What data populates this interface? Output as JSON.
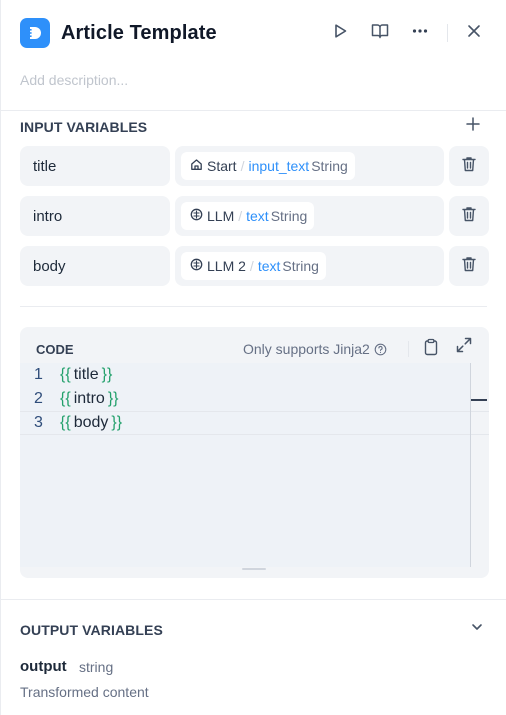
{
  "header": {
    "title": "Article Template",
    "run_icon": "play-icon",
    "docs_icon": "book-open-icon",
    "more_icon": "more-horizontal-icon",
    "close_icon": "close-icon"
  },
  "description_placeholder": "Add description...",
  "input_section": {
    "title": "INPUT VARIABLES",
    "add_icon": "plus-icon",
    "variables": [
      {
        "name": "title",
        "node_icon": "home-icon",
        "node": "Start",
        "var": "input_text",
        "type": "String"
      },
      {
        "name": "intro",
        "node_icon": "llm-icon",
        "node": "LLM",
        "var": "text",
        "type": "String"
      },
      {
        "name": "body",
        "node_icon": "llm-icon",
        "node": "LLM 2",
        "var": "text",
        "type": "String"
      }
    ]
  },
  "code": {
    "label": "CODE",
    "hint": "Only supports Jinja2",
    "lines": [
      {
        "num": "1",
        "open": "{{",
        "var": "title",
        "close": "}}"
      },
      {
        "num": "2",
        "open": "{{",
        "var": "intro",
        "close": "}}"
      },
      {
        "num": "3",
        "open": "{{",
        "var": "body",
        "close": "}}"
      }
    ]
  },
  "output_section": {
    "title": "OUTPUT VARIABLES",
    "name": "output",
    "type": "string",
    "description": "Transformed content"
  },
  "colors": {
    "accent": "#2e90fa",
    "jinja_brace": "#22a06b"
  }
}
